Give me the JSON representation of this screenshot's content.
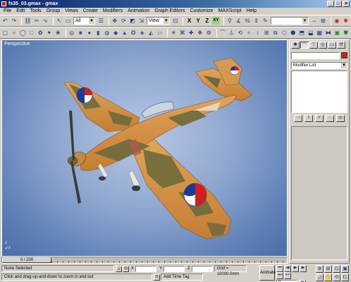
{
  "window": {
    "title": "fs35_03.gmax - gmax",
    "buttons": [
      "_",
      "□",
      "×"
    ]
  },
  "menu": [
    "File",
    "Edit",
    "Tools",
    "Group",
    "Views",
    "Create",
    "Modifiers",
    "Animation",
    "Graph Editors",
    "Customize",
    "MAXScript",
    "Help"
  ],
  "toolbar": {
    "selection_filter": "All",
    "coord_system": "View",
    "axis_labels": [
      "X",
      "Y",
      "Z",
      "XY"
    ]
  },
  "viewport": {
    "label": "Perspective",
    "background": "#8ea6cf"
  },
  "timeline": {
    "slider_label": "0 / 200"
  },
  "status": {
    "selection": "None Selected",
    "prompt": "Click and drag-up-and-down to zoom in and out",
    "x_label": "X",
    "y_label": "Y",
    "z_label": "Z",
    "grid": "Grid = 10000.0mm",
    "add_time_tag": "Add Time Tag",
    "animate": "Animate",
    "frame": "0"
  },
  "command_panel": {
    "modifier_list": "Modifier List",
    "object_color": "#c8201c"
  },
  "icons": {
    "toolbar1": [
      "undo-icon",
      "redo-icon",
      "link-icon",
      "unlink-icon",
      "bind-icon",
      "select-icon",
      "select-region-icon",
      "select-by-name-icon",
      "move-icon",
      "rotate-icon",
      "scale-icon",
      "pivot-icon",
      "mirror-icon",
      "align-icon",
      "material-icon",
      "render-icon"
    ],
    "toolbar2": [
      "box-icon",
      "sphere-icon",
      "cylinder-icon",
      "torus-icon",
      "teapot-icon",
      "cone-icon",
      "geosphere-icon",
      "tube-icon",
      "pyramid-icon",
      "plane-icon"
    ]
  }
}
